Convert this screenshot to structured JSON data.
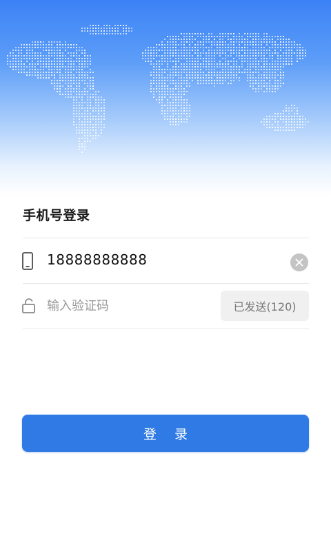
{
  "colors": {
    "header_top": "#3b82f6",
    "primary_button": "#2f7ae5",
    "send_button_bg": "#f0f0f0",
    "clear_icon_bg": "#c4c4c4"
  },
  "page": {
    "title": "手机号登录"
  },
  "phone_row": {
    "icon": "phone-icon",
    "value": "18888888888",
    "clear_icon": "clear-icon"
  },
  "code_row": {
    "icon": "unlock-icon",
    "placeholder": "输入验证码",
    "send_button_label": "已发送(120)"
  },
  "login_button": {
    "label": "登 录"
  }
}
